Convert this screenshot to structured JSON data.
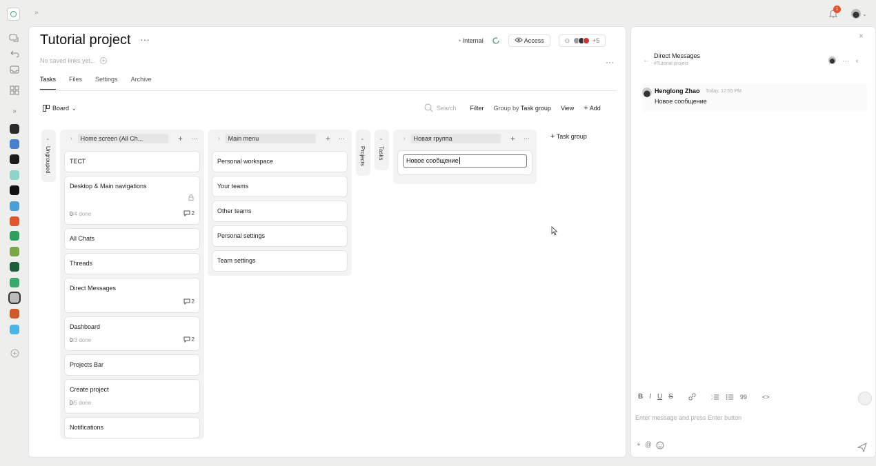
{
  "topbar": {
    "expand": "»",
    "notification_count": "1",
    "user_caret": "⌄"
  },
  "rail": {
    "icons": [
      "chat-icon",
      "undo-icon",
      "inbox-icon",
      "apps-icon",
      "collapse-icon"
    ],
    "apps": [
      "#2b2b2b",
      "#4a7fd0",
      "#1b1b1b",
      "#8fd3c9",
      "#111111",
      "#4aa0d6",
      "#e2562b",
      "#2e9e5c",
      "#7aa64a",
      "#1d5e3a",
      "#3aa86a",
      "#bbbbbb",
      "#d05a2a",
      "#4ab3e8"
    ],
    "add": "+"
  },
  "project": {
    "title": "Tutorial project",
    "saved_links": "No saved links yet...",
    "visibility": "Internal",
    "access": "Access",
    "members_more": "+5",
    "tabs": [
      "Tasks",
      "Files",
      "Settings",
      "Archive"
    ]
  },
  "toolbar": {
    "board": "Board",
    "search_placeholder": "Search",
    "filter": "Filter",
    "group_by_label": "Group by",
    "group_by_value": "Task group",
    "view": "View",
    "add": "Add"
  },
  "columns": {
    "ungrouped": "Ungrouped",
    "home": {
      "title": "Home screen (All Ch...",
      "cards": [
        {
          "title": "ТЕСТ"
        },
        {
          "title": "Desktop & Main navigations",
          "done_n": "0",
          "done_total": "/4 done",
          "comments": "2"
        },
        {
          "title": "All Chats"
        },
        {
          "title": "Threads"
        },
        {
          "title": "Direct Messages",
          "comments": "2"
        },
        {
          "title": "Dashboard",
          "done_n": "0",
          "done_total": "/3 done",
          "comments": "2"
        },
        {
          "title": "Projects Bar"
        },
        {
          "title": "Create project",
          "done_n": "0",
          "done_total": "/5 done"
        },
        {
          "title": "Notifications"
        }
      ]
    },
    "main_menu": {
      "title": "Main menu",
      "cards": [
        "Personal workspace",
        "Your teams",
        "Other teams",
        "Personal settings",
        "Team settings"
      ]
    },
    "projects": "Projects",
    "tasks": "Tasks",
    "new_group": {
      "title": "Новая группа",
      "input_value": "Новое сообщение"
    },
    "add_group": "Task group"
  },
  "chat": {
    "title": "Direct Messages",
    "subtitle": "#Tutorial project",
    "message": {
      "author": "Henglong Zhao",
      "time": "Today, 12:55 PM",
      "text": "Новое сообщение"
    },
    "format": {
      "bold": "B",
      "italic": "I",
      "underline": "U",
      "strike": "S",
      "quote": "99",
      "code": "<>"
    },
    "input_placeholder": "Enter message and press Enter button"
  }
}
